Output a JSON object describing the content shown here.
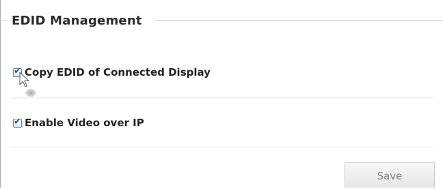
{
  "panel": {
    "title": "EDID Management"
  },
  "options": [
    {
      "label": "Copy EDID of Connected Display",
      "checked": true
    },
    {
      "label": "Enable Video over IP",
      "checked": true
    }
  ],
  "actions": {
    "save_label": "Save"
  },
  "icons": {
    "checkmark": "checkmark-icon",
    "cursor": "mouse-pointer-icon"
  }
}
